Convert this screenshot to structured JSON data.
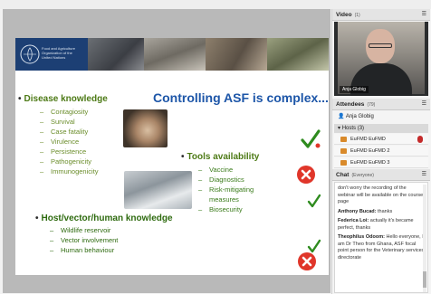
{
  "slide": {
    "fao_text": "Food and Agriculture Organization of the United Nations",
    "title": "Controlling ASF is complex...",
    "disease": {
      "heading": "Disease knowledge",
      "items": [
        "Contagiosity",
        "Survival",
        "Case fatality",
        "Virulence",
        "Persistence",
        "Pathogenicity",
        "Immunogenicity"
      ]
    },
    "tools": {
      "heading": "Tools availability",
      "items": [
        "Vaccine",
        "Diagnostics",
        "Risk-mitigating",
        "measures",
        "Biosecurity"
      ]
    },
    "host": {
      "heading": "Host/vector/human knowledge",
      "items": [
        "Wildlife reservoir",
        "Vector involvement",
        "Human behaviour"
      ]
    },
    "bullet": "•",
    "dash": "–"
  },
  "video": {
    "title": "Video",
    "count": "(1)",
    "speaker": "Anja Globig"
  },
  "attendees": {
    "title": "Attendees",
    "count": "(79)",
    "self": "Anja Globig",
    "hosts_label": "Hosts (3)",
    "hosts": [
      "EuFMD EuFMD",
      "EuFMD EuFMD 2",
      "EuFMD EuFMD 3"
    ]
  },
  "chat": {
    "title": "Chat",
    "scope": "(Everyone)",
    "messages": [
      {
        "author": "",
        "text": "don't worry the recording of the webinar will be available on the course page"
      },
      {
        "author": "Anthony Bucad:",
        "text": "thanks"
      },
      {
        "author": "Federica Loi:",
        "text": "actually it's became perfect, thanks"
      },
      {
        "author": "Theophilus Odoom:",
        "text": "Hello everyone, I am Dr Theo from Ghana, ASF focal point person for the Veterinary services directorate"
      }
    ]
  },
  "colors": {
    "header_blue": "#1c3f74",
    "title_blue": "#1d56a8",
    "heading_green": "#4d7a16",
    "check_green": "#2e8b1e",
    "cross_red": "#e0362a"
  },
  "icons": {
    "check": "check-icon",
    "cross": "cross-circle-icon",
    "mic": "microphone-icon",
    "person": "person-icon"
  }
}
